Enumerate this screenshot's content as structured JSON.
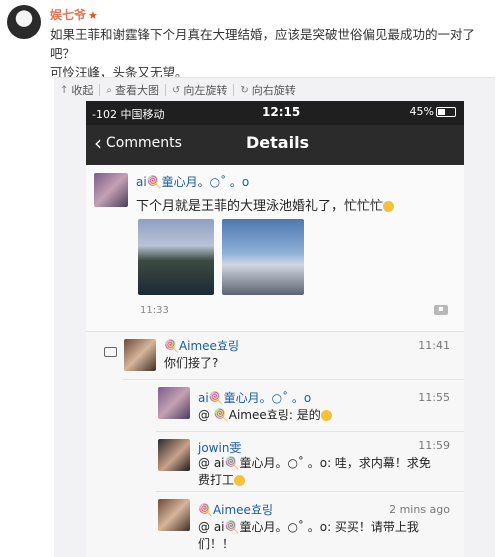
{
  "post": {
    "author": "娱七爷",
    "author_badge": "★",
    "text_line1": "如果王菲和谢霆锋下个月真在大理结婚，应该是突破世俗偏见最成功的一对了吧？",
    "text_line2": "可怜汪峰，头条又无望。"
  },
  "toolbar": {
    "collapse": "收起",
    "view_large": "查看大图",
    "rotate_left": "向左旋转",
    "rotate_right": "向右旋转"
  },
  "phone": {
    "status": {
      "carrier": "-102 中国移动",
      "time": "12:15",
      "battery": "45%"
    },
    "nav": {
      "back": "Comments",
      "title": "Details"
    },
    "detail": {
      "username": "ai🍭童心月。○˚ 。o",
      "text": "下个月就是王菲的大理泳池婚礼了，忙忙忙",
      "time": "11:33"
    },
    "comments": [
      {
        "user": "🍭Aimee효링",
        "text": "你们接了?",
        "time": "11:41"
      },
      {
        "user": "ai🍭童心月。○˚ 。o",
        "text": "@ 🍭Aimee효링: 是的",
        "time": "11:55"
      },
      {
        "user": "jowin雯",
        "text": "@ ai🍭童心月。○˚ 。o: 哇，求内幕！求免费打工",
        "time": "11:59"
      },
      {
        "user": "🍭Aimee효링",
        "text": "@ ai🍭童心月。○˚ 。o: 买买！请带上我们！！",
        "time": "2 mins ago"
      }
    ]
  },
  "colors": {
    "author": "#eb7350",
    "nav_bg": "#2b2b2b",
    "username": "#1e5ba8"
  }
}
